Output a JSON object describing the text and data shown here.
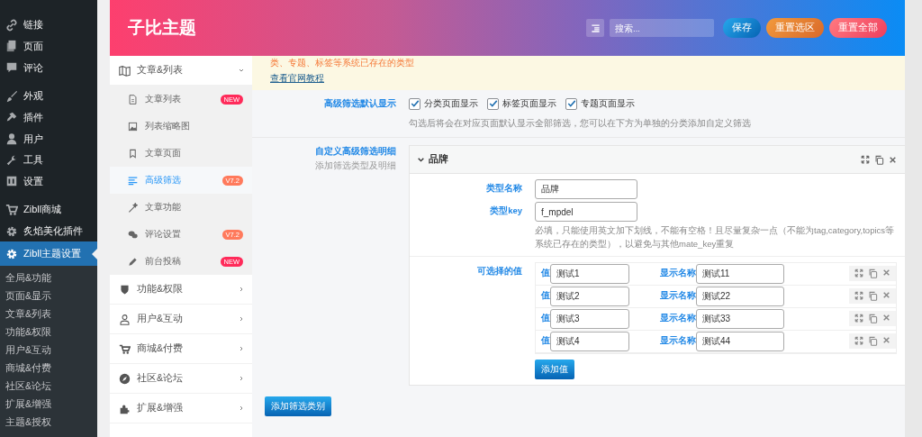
{
  "admin_menu": {
    "items": [
      {
        "label": "链接",
        "selected": false
      },
      {
        "label": "页面",
        "selected": false
      },
      {
        "label": "评论",
        "selected": false
      },
      {
        "label": "外观",
        "selected": false
      },
      {
        "label": "插件",
        "selected": false
      },
      {
        "label": "用户",
        "selected": false
      },
      {
        "label": "工具",
        "selected": false
      },
      {
        "label": "设置",
        "selected": false
      },
      {
        "label": "Zibll商城",
        "selected": false
      },
      {
        "label": "炙焰美化插件",
        "selected": false
      },
      {
        "label": "Zibll主题设置",
        "selected": true
      }
    ],
    "submenu": [
      "全局&功能",
      "页面&显示",
      "文章&列表",
      "功能&权限",
      "用户&互动",
      "商城&付费",
      "社区&论坛",
      "扩展&增强",
      "主题&授权"
    ]
  },
  "header": {
    "title": "子比主题",
    "search": {
      "placeholder": "搜索..."
    },
    "buttons": [
      "保存",
      "重置选区",
      "重置全部"
    ]
  },
  "nav": [
    {
      "label": "文章&列表",
      "expanded": true,
      "children": [
        {
          "label": "文章列表",
          "selected": false,
          "badge": "NEW",
          "color": "#ff2b5a"
        },
        {
          "label": "列表缩略图",
          "selected": false
        },
        {
          "label": "文章页面",
          "selected": false
        },
        {
          "label": "高级筛选",
          "selected": true,
          "badge": "V7.2",
          "color": "#ff7a5c"
        },
        {
          "label": "文章功能",
          "selected": false
        },
        {
          "label": "评论设置",
          "selected": false,
          "badge": "V7.2",
          "color": "#ff7a5c"
        },
        {
          "label": "前台投稿",
          "selected": false,
          "badge": "NEW",
          "color": "#ff2b5a"
        }
      ]
    },
    {
      "label": "功能&权限",
      "expanded": false
    },
    {
      "label": "用户&互动",
      "expanded": false
    },
    {
      "label": "商城&付费",
      "expanded": false
    },
    {
      "label": "社区&论坛",
      "expanded": false
    },
    {
      "label": "扩展&增强",
      "expanded": false
    }
  ],
  "notice": {
    "text": "类、专题、标签等系统已存在的类型",
    "link": "查看官网教程"
  },
  "default_display": {
    "label": "高级筛选默认显示",
    "options": [
      {
        "label": "分类页面显示",
        "checked": true
      },
      {
        "label": "标签页面显示",
        "checked": true
      },
      {
        "label": "专题页面显示",
        "checked": true
      }
    ],
    "hint": "勾选后将会在对应页面默认显示全部筛选，您可以在下方为单独的分类添加自定义筛选"
  },
  "custom_filters": {
    "label": "自定义高级筛选明细",
    "sublabel": "添加筛选类型及明细",
    "group": {
      "title": "品牌",
      "expanded": true,
      "name_label": "类型名称",
      "name_value": "品牌",
      "key_label": "类型key",
      "key_value": "f_mpdel",
      "key_hint": "必填，只能使用英文加下划线，不能有空格！且尽量复杂一点（不能为tag,category,topics等系统已存在的类型），以避免与其他mate_key重复",
      "values_label": "可选择的值",
      "values": [
        {
          "value_label": "值",
          "value": "测试1",
          "name_label": "显示名称",
          "name": "测试11"
        },
        {
          "value_label": "值",
          "value": "测试2",
          "name_label": "显示名称",
          "name": "测试22"
        },
        {
          "value_label": "值",
          "value": "测试3",
          "name_label": "显示名称",
          "name": "测试33"
        },
        {
          "value_label": "值",
          "value": "测试4",
          "name_label": "显示名称",
          "name": "测试44"
        }
      ],
      "add_value": "添加值"
    },
    "add_group": "添加筛选类别"
  }
}
